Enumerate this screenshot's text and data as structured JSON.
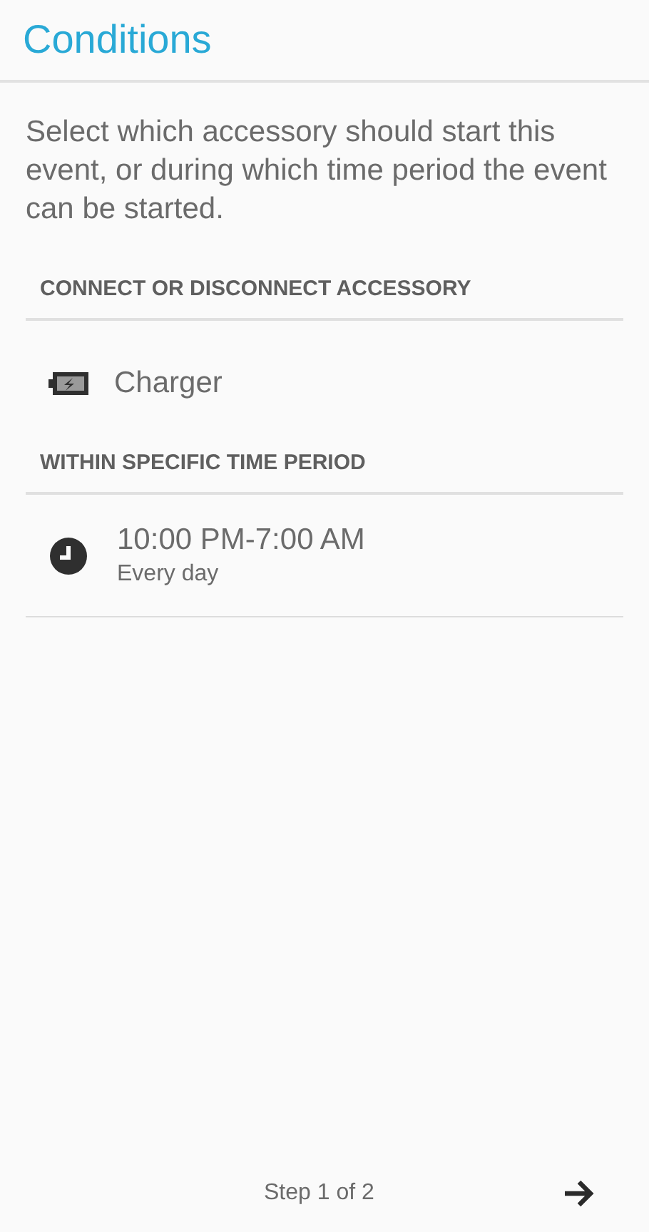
{
  "header": {
    "title": "Conditions"
  },
  "description": "Select which accessory should start this event, or during which time period the event can be started.",
  "sections": [
    {
      "title": "CONNECT OR DISCONNECT ACCESSORY",
      "items": [
        {
          "kind": "accessory",
          "label": "Charger"
        }
      ]
    },
    {
      "title": "WITHIN SPECIFIC TIME PERIOD",
      "items": [
        {
          "kind": "time",
          "label": "10:00 PM-7:00 AM",
          "subtitle": "Every day"
        }
      ]
    }
  ],
  "footer": {
    "step": "Step 1 of 2"
  }
}
